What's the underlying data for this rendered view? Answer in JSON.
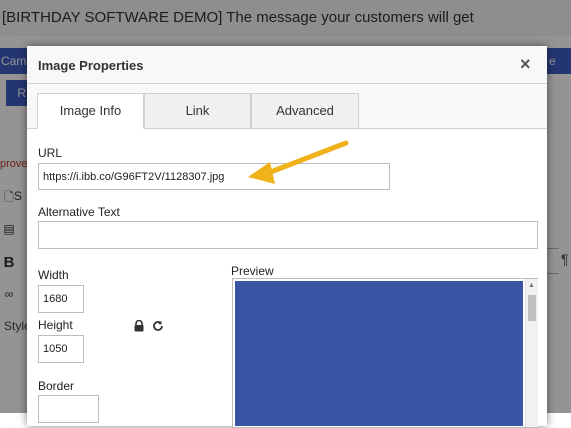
{
  "background": {
    "title": "[BIRTHDAY SOFTWARE DEMO] The message your customers will get",
    "camp_label": "Camp",
    "right_label": "e",
    "button_label": "R",
    "approve_text": "prove",
    "side_s": "S",
    "style_label": "Style",
    "bold_label": "B",
    "para_icon": "¶",
    "colors": {
      "accent": "#3e5dc4",
      "overlay": "rgba(0,0,0,0.42)"
    }
  },
  "dialog": {
    "title": "Image Properties",
    "close_label": "×",
    "tabs": [
      {
        "label": "Image Info",
        "active": true
      },
      {
        "label": "Link",
        "active": false
      },
      {
        "label": "Advanced",
        "active": false
      }
    ],
    "url": {
      "label": "URL",
      "value": "https://i.ibb.co/G96FT2V/1128307.jpg"
    },
    "alt_text": {
      "label": "Alternative Text",
      "value": ""
    },
    "width": {
      "label": "Width",
      "value": "1680"
    },
    "height": {
      "label": "Height",
      "value": "1050"
    },
    "border": {
      "label": "Border",
      "value": ""
    },
    "lock_icon": "lock-icon",
    "reset_icon": "reset-icon",
    "preview": {
      "label": "Preview",
      "image_color": "#3a54a3"
    },
    "annotation_arrow_color": "#f0b21a"
  }
}
